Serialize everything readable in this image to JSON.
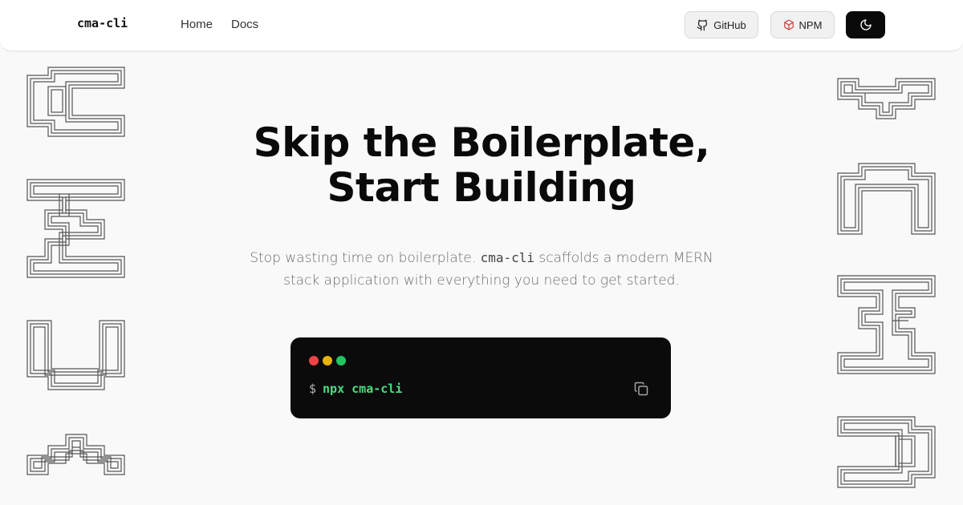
{
  "header": {
    "brand": "cma-cli",
    "nav": [
      {
        "label": "Home"
      },
      {
        "label": "Docs"
      }
    ],
    "github_label": "GitHub",
    "npm_label": "NPM",
    "theme_icon": "moon-icon"
  },
  "hero": {
    "title_line1": "Skip the Boilerplate,",
    "title_line2": "Start Building",
    "subtitle_before": "Stop wasting time on boilerplate.",
    "subtitle_code": "cma-cli",
    "subtitle_after": "scaffolds a modern MERN stack application with everything you need to get started."
  },
  "terminal": {
    "prompt": "$",
    "command": "npx cma-cli",
    "copy_icon": "copy-icon"
  },
  "colors": {
    "accent_green": "#4ade80",
    "npm_red": "#cb3837",
    "dot_red": "#ef4444",
    "dot_yellow": "#eab308",
    "dot_green": "#22c55e"
  }
}
